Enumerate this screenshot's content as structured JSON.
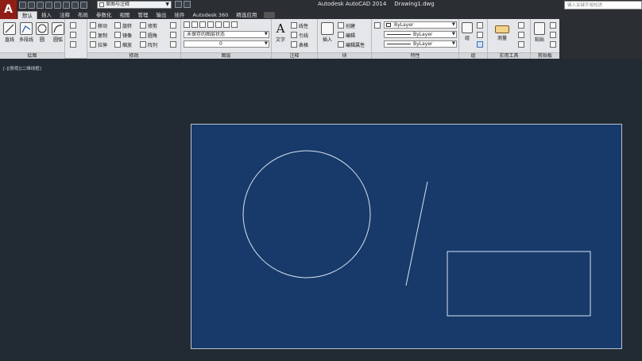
{
  "app": {
    "logo_letter": "A",
    "title": "Autodesk AutoCAD 2014",
    "file": "Drawing1.dwg"
  },
  "workspace": {
    "label": "草图与注释"
  },
  "search": {
    "placeholder": "键入关键字或短语"
  },
  "tabs": [
    "默认",
    "插入",
    "注释",
    "布局",
    "参数化",
    "视图",
    "管理",
    "输出",
    "插件",
    "Autodesk 360",
    "精选应用"
  ],
  "ribbon": {
    "draw": {
      "title": "绘图",
      "line": "直线",
      "polyline": "多段线",
      "circle": "圆",
      "arc": "圆弧"
    },
    "modify": {
      "title": "修改",
      "move": "移动",
      "rotate": "旋转",
      "trim": "修剪",
      "copy": "复制",
      "mirror": "镜像",
      "fillet": "圆角",
      "stretch": "拉伸",
      "scale": "缩放",
      "array": "阵列"
    },
    "layers": {
      "title": "图层",
      "layer_state": "未保存的图层状态",
      "current_layer": "0"
    },
    "annotation": {
      "title": "注释",
      "text": "文字",
      "linear": "线性",
      "leader": "引线",
      "table": "表格"
    },
    "block": {
      "title": "块",
      "insert": "插入",
      "create": "创建",
      "edit": "编辑",
      "edit_attr": "编辑属性"
    },
    "properties": {
      "title": "特性",
      "color": "ByLayer",
      "linetype": "ByLayer",
      "lineweight": "ByLayer"
    },
    "groups": {
      "title": "组",
      "group": "组"
    },
    "utilities": {
      "title": "实用工具",
      "measure": "测量"
    },
    "clipboard": {
      "title": "剪贴板",
      "paste": "粘贴"
    }
  },
  "viewport": {
    "label": "[-][俯视][二维线框]"
  },
  "colors": {
    "canvas": "#222a33",
    "paper": "#173a6b",
    "linework": "#d8e2f0",
    "app_button": "#8f1f16"
  }
}
